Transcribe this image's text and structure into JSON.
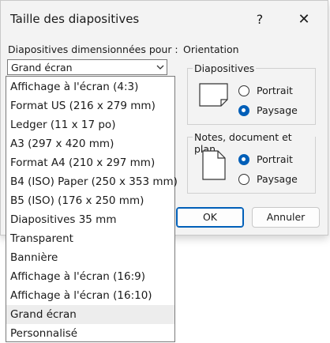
{
  "dialog": {
    "title": "Taille des diapositives",
    "help_label": "?",
    "close_label": "✕"
  },
  "size": {
    "label": "Diapositives dimensionnées pour :",
    "selected": "Grand écran",
    "options": [
      "Affichage à l'écran (4:3)",
      "Format US (216 x 279 mm)",
      "Ledger (11 x 17 po)",
      "A3 (297 x 420 mm)",
      "Format A4 (210 x 297 mm)",
      "B4 (ISO) Paper (250 x 353 mm)",
      "B5 (ISO) (176 x 250 mm)",
      "Diapositives 35 mm",
      "Transparent",
      "Bannière",
      "Affichage à l'écran (16:9)",
      "Affichage à l'écran (16:10)",
      "Grand écran",
      "Personnalisé"
    ]
  },
  "orientation": {
    "label": "Orientation",
    "slides": {
      "title": "Diapositives",
      "portrait": "Portrait",
      "landscape": "Paysage",
      "selected": "landscape"
    },
    "notes": {
      "title": "Notes, document et plan",
      "portrait": "Portrait",
      "landscape": "Paysage",
      "selected": "portrait"
    }
  },
  "buttons": {
    "ok": "OK",
    "cancel": "Annuler"
  },
  "colors": {
    "accent": "#005fb8",
    "dialog_bg": "#f3f3f3"
  }
}
